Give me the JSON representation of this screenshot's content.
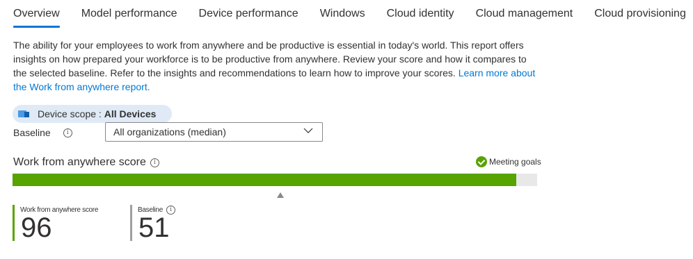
{
  "tabs": [
    {
      "label": "Overview",
      "active": true
    },
    {
      "label": "Model performance",
      "active": false
    },
    {
      "label": "Device performance",
      "active": false
    },
    {
      "label": "Windows",
      "active": false
    },
    {
      "label": "Cloud identity",
      "active": false
    },
    {
      "label": "Cloud management",
      "active": false
    },
    {
      "label": "Cloud provisioning",
      "active": false
    }
  ],
  "description": {
    "text": "The ability for your employees to work from anywhere and be productive is essential in today's world. This report offers insights on how prepared your workforce is to be productive from anywhere. Review your score and how it compares to the selected baseline. Refer to the insights and recommendations to learn how to improve your scores.",
    "link": "Learn more about the Work from anywhere report."
  },
  "device_scope": {
    "label": "Device scope",
    "separator": " : ",
    "value": "All Devices",
    "icon": "device-scope-icon"
  },
  "baseline": {
    "label": "Baseline",
    "info_icon": "info-icon",
    "selected": "All organizations (median)"
  },
  "score_section": {
    "title": "Work from anywhere score",
    "status": "Meeting goals",
    "status_color": "#57a300",
    "score_fraction": 0.96,
    "baseline_fraction": 0.51
  },
  "metrics": {
    "score_label": "Work from anywhere score",
    "score_value": "96",
    "baseline_label": "Baseline",
    "baseline_value": "51"
  },
  "colors": {
    "accent": "#0078d4",
    "good": "#57a300",
    "baseline": "#a19f9d"
  }
}
